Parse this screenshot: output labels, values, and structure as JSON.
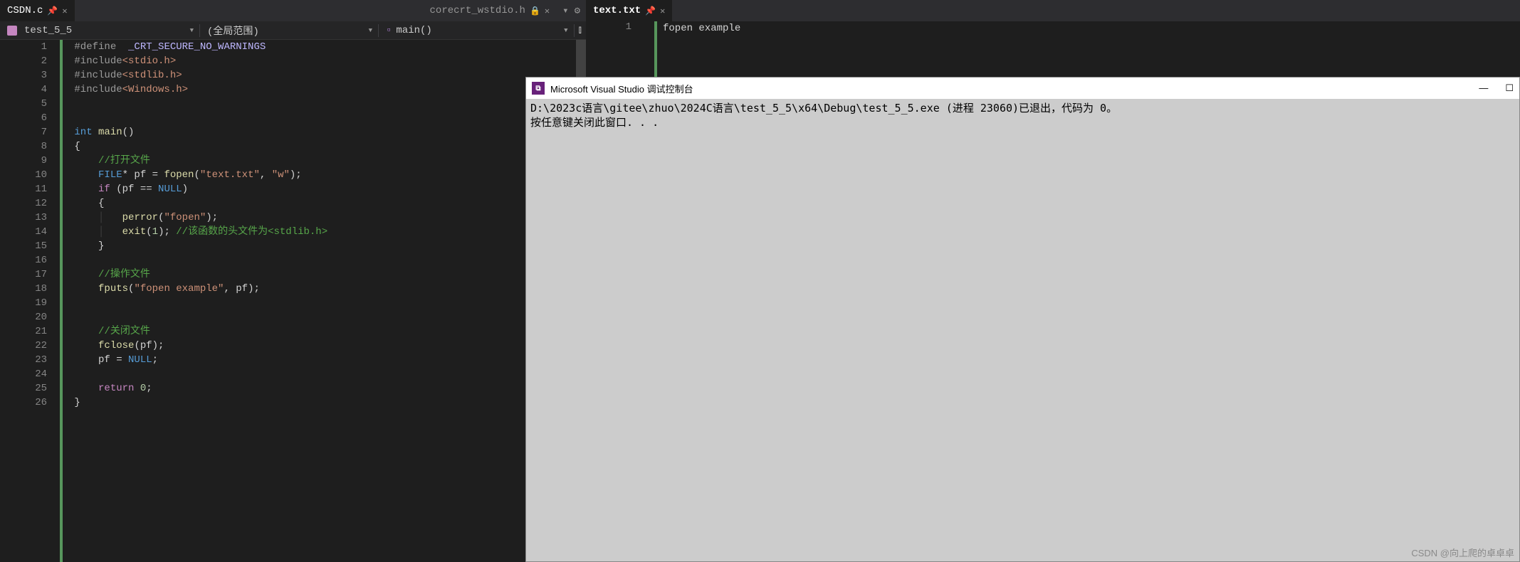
{
  "leftTabs": {
    "tab1": {
      "label": "CSDN.c"
    },
    "tab2": {
      "label": "corecrt_wstdio.h"
    }
  },
  "crumbs": {
    "file": "test_5_5",
    "scope": "(全局范围)",
    "func": "main()"
  },
  "code": {
    "lines": [
      "1",
      "2",
      "3",
      "4",
      "5",
      "6",
      "7",
      "8",
      "9",
      "10",
      "11",
      "12",
      "13",
      "14",
      "15",
      "16",
      "17",
      "18",
      "19",
      "20",
      "21",
      "22",
      "23",
      "24",
      "25",
      "26"
    ],
    "l1_define": "#define",
    "l1_macro": "_CRT_SECURE_NO_WARNINGS",
    "l2_inc": "#include",
    "l2_hdr": "<stdio.h>",
    "l3_inc": "#include",
    "l3_hdr": "<stdlib.h>",
    "l4_inc": "#include",
    "l4_hdr": "<Windows.h>",
    "l7_int": "int",
    "l7_main": "main",
    "l9_comment": "//打开文件",
    "l10_file": "FILE",
    "l10_pf": "* pf = ",
    "l10_fopen": "fopen",
    "l10_s1": "\"text.txt\"",
    "l10_s2": "\"w\"",
    "l11_if": "if",
    "l11_cond": " (pf == ",
    "l11_null": "NULL",
    "l13_perror": "perror",
    "l13_s": "\"fopen\"",
    "l14_exit": "exit",
    "l14_n": "1",
    "l14_comment": "//该函数的头文件为<stdlib.h>",
    "l17_comment": "//操作文件",
    "l18_fputs": "fputs",
    "l18_s": "\"fopen example\"",
    "l18_pf": ", pf);",
    "l21_comment": "//关闭文件",
    "l22_fclose": "fclose",
    "l22_arg": "(pf);",
    "l23": "pf = ",
    "l23_null": "NULL",
    "l25_ret": "return",
    "l25_n": "0"
  },
  "rightTab": {
    "label": "text.txt"
  },
  "rightEditor": {
    "line1_num": "1",
    "line1_text": "fopen example"
  },
  "console": {
    "title": "Microsoft Visual Studio 调试控制台",
    "line1": "D:\\2023c语言\\gitee\\zhuo\\2024C语言\\test_5_5\\x64\\Debug\\test_5_5.exe (进程 23060)已退出，代码为 0。",
    "line2": "按任意键关闭此窗口. . ."
  },
  "watermark": "CSDN @向上爬的卓卓卓"
}
